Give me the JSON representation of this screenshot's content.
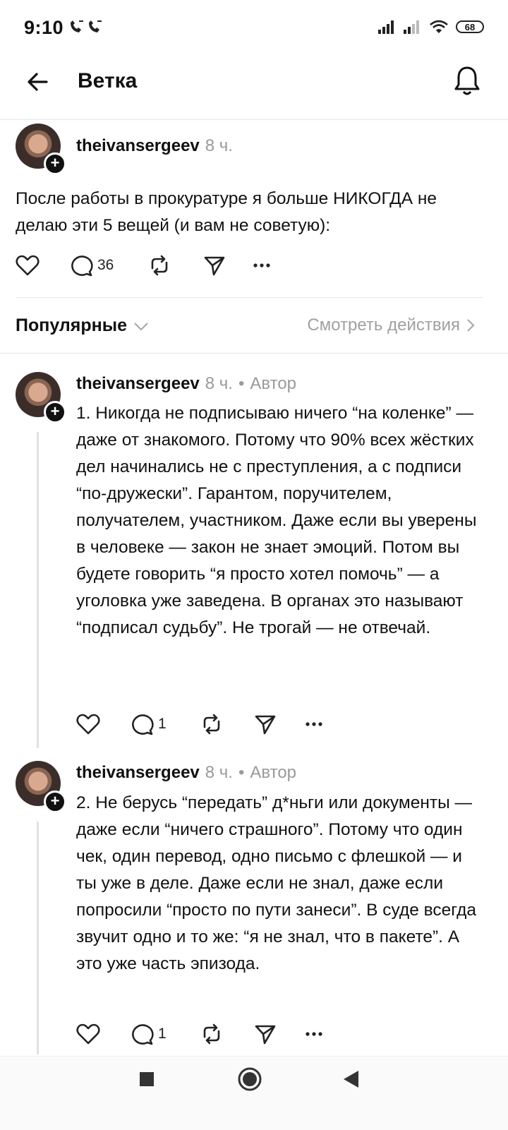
{
  "status_bar": {
    "time": "9:10",
    "battery": "68"
  },
  "header": {
    "title": "Ветка"
  },
  "post": {
    "username": "theivansergeev",
    "time": "8 ч.",
    "text": "После работы в прокуратуре я больше НИКОГДА не делаю эти 5 вещей (и вам не советую):",
    "reply_count": "36"
  },
  "sort_bar": {
    "label": "Популярные",
    "activity": "Смотреть действия"
  },
  "replies": [
    {
      "username": "theivansergeev",
      "time": "8 ч.",
      "separator": "•",
      "badge": "Автор",
      "text": "1. Никогда не подписываю ничего “на коленке” — даже от знакомого. Потому что 90% всех жёстких дел начинались не с преступления, а с подписи “по-дружески”. Гарантом, поручителем, получателем, участником. Даже если вы уверены в человеке — закон не знает эмоций. Потом вы будете говорить “я просто хотел помочь” — а уголовка уже заведена. В органах это называют “подписал судьбу”. Не трогай — не отвечай.",
      "reply_count": "1"
    },
    {
      "username": "theivansergeev",
      "time": "8 ч.",
      "separator": "•",
      "badge": "Автор",
      "text": "2. Не берусь “передать” д*ньги или документы — даже если “ничего страшного”. Потому что один чек, один перевод, одно письмо с флешкой — и ты уже в деле. Даже если не знал, даже если попросили “просто по пути занеси”. В суде всегда звучит одно и то же: “я не знал, что в пакете”. А это уже часть эпизода.",
      "reply_count": "1"
    }
  ],
  "icons": {
    "like": "heart-icon",
    "reply": "comment-icon",
    "repost": "repost-icon",
    "share": "send-icon",
    "more": "more-icon",
    "back": "arrow-left-icon",
    "bell": "bell-icon"
  }
}
